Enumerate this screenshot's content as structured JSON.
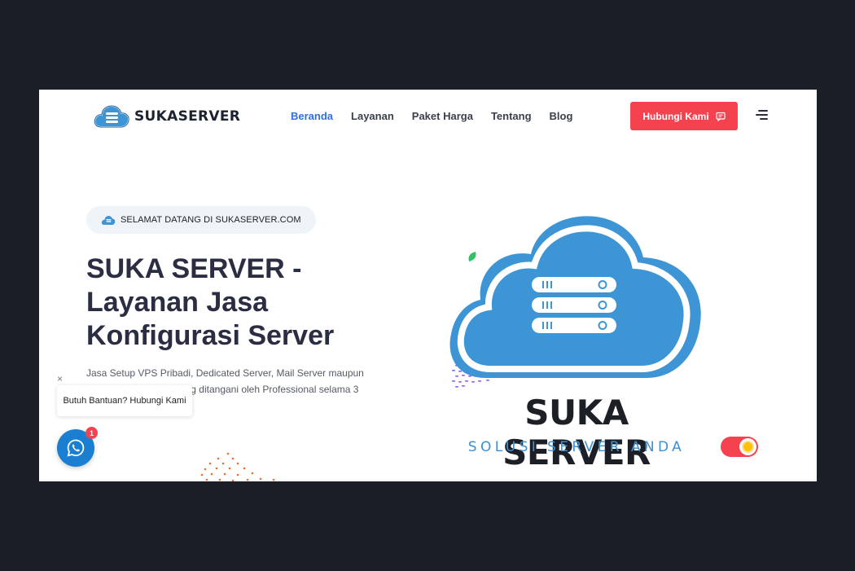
{
  "header": {
    "logo_text": "SUKASERVER",
    "nav": [
      {
        "label": "Beranda",
        "active": true
      },
      {
        "label": "Layanan"
      },
      {
        "label": "Paket Harga"
      },
      {
        "label": "Tentang"
      },
      {
        "label": "Blog"
      }
    ],
    "cta_label": "Hubungi Kami",
    "cta_icon": "message-icon",
    "menu_icon": "hamburger-menu-icon"
  },
  "hero": {
    "badge_text": "SELAMAT DATANG DI SUKASERVER.COM",
    "title_lines": [
      "SUKA SERVER -",
      "Layanan Jasa",
      "Konfigurasi Server"
    ],
    "description": "Jasa Setup VPS Pribadi, Dedicated Server, Mail Server maupun Virtual Web Hosting yang ditangani oleh Professional selama 3 tahun.",
    "brand_title": "SUKA SERVER",
    "brand_subtitle": "SOLUSI SERVER ANDA"
  },
  "whatsapp_widget": {
    "close_label": "×",
    "bubble_text": "Butuh Bantuan? Hubungi Kami",
    "notification_count": "1",
    "icon": "whatsapp-icon"
  },
  "theme_toggle": {
    "icon": "sun-icon",
    "state": "light"
  },
  "colors": {
    "accent": "#f5424f",
    "nav_active": "#2f6fe4",
    "cloud_blue": "#3d95d6",
    "page_background": "#1a1f27",
    "heading": "#2b2d42"
  }
}
